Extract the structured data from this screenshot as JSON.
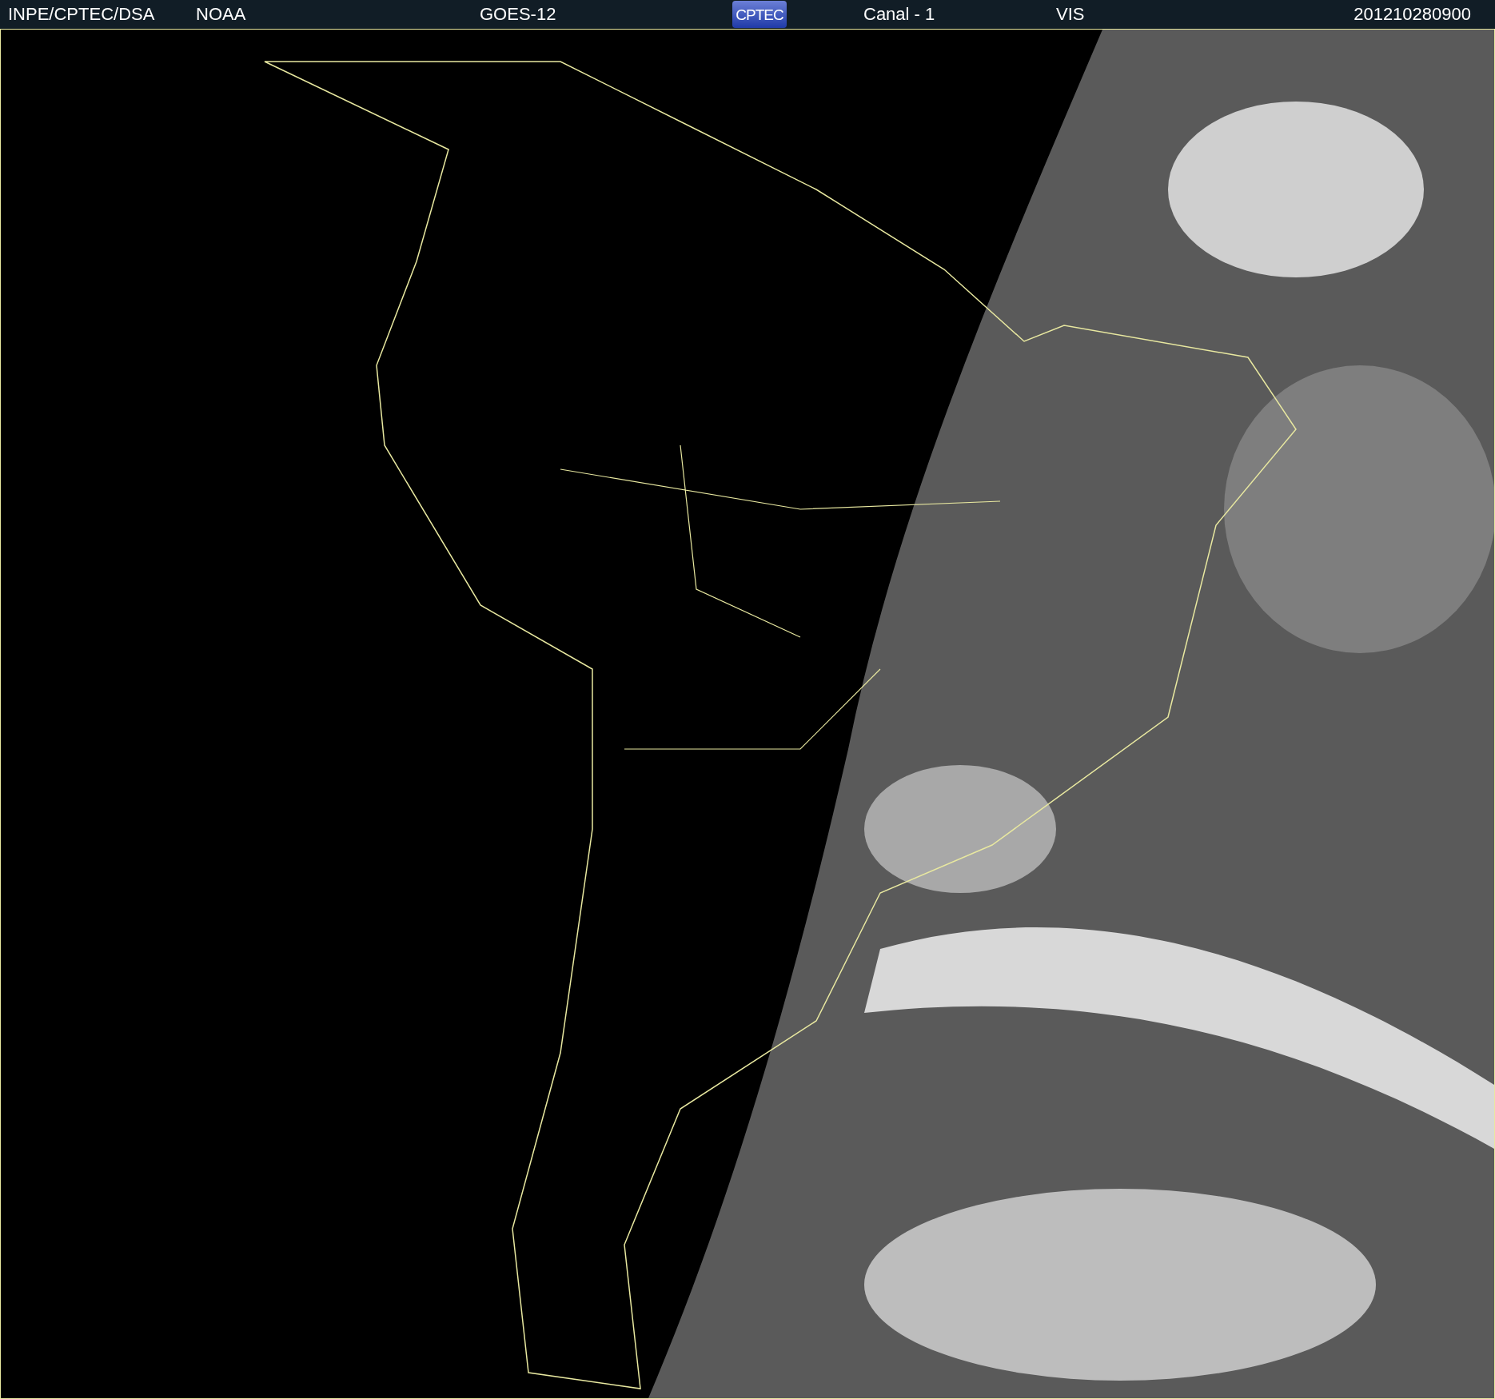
{
  "header": {
    "source": "INPE/CPTEC/DSA",
    "agency": "NOAA",
    "satellite": "GOES-12",
    "logo": "CPTEC",
    "channel": "Canal - 1",
    "band": "VIS",
    "timestamp": "201210280900"
  }
}
